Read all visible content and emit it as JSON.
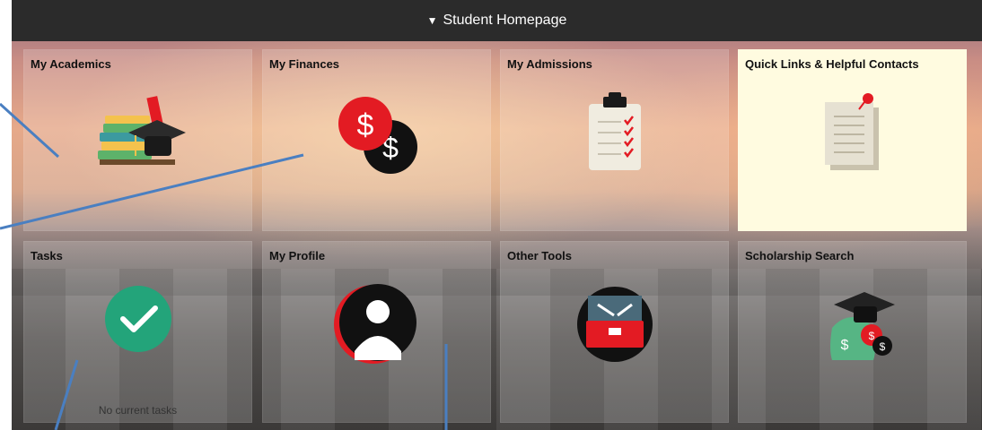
{
  "header": {
    "caret": "▼",
    "title": "Student Homepage"
  },
  "tiles": [
    {
      "title": "My Academics",
      "icon": "academics-icon"
    },
    {
      "title": "My Finances",
      "icon": "finances-icon"
    },
    {
      "title": "My Admissions",
      "icon": "admissions-icon"
    },
    {
      "title": "Quick Links & Helpful Contacts",
      "icon": "quick-links-icon"
    },
    {
      "title": "Tasks",
      "icon": "tasks-check-icon",
      "footer": "No current tasks"
    },
    {
      "title": "My Profile",
      "icon": "profile-icon"
    },
    {
      "title": "Other Tools",
      "icon": "toolbox-icon"
    },
    {
      "title": "Scholarship Search",
      "icon": "scholarship-icon"
    }
  ],
  "colors": {
    "header_bg": "#2b2b2b",
    "accent_red": "#e31b23",
    "check_green": "#23a47a",
    "annotation_blue": "#4a7fc1",
    "highlight_tile": "#fffbe0"
  }
}
